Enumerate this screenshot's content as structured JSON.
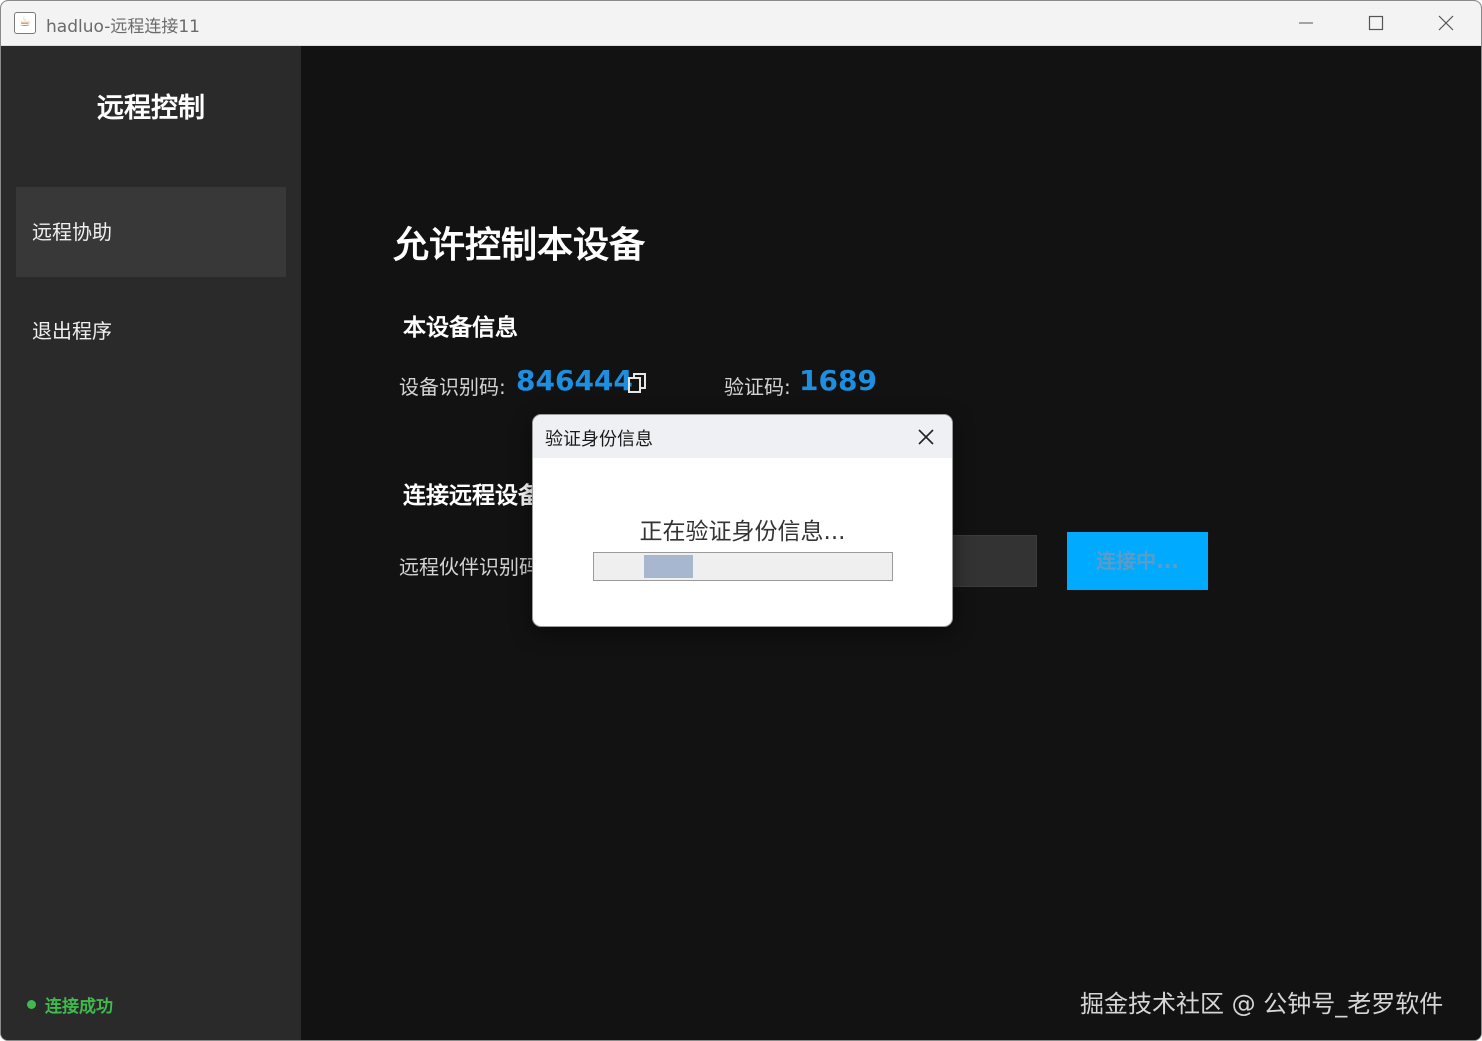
{
  "window": {
    "title": "hadluo-远程连接11",
    "icon": "java-cup-icon",
    "controls": [
      "minimize-icon",
      "maximize-icon",
      "close-icon"
    ]
  },
  "sidebar": {
    "brand": "远程控制",
    "items": [
      {
        "label": "远程协助",
        "active": true
      },
      {
        "label": "退出程序",
        "active": false
      }
    ],
    "status": "连接成功",
    "status_color": "#3fba4d"
  },
  "main": {
    "title": "允许控制本设备",
    "device_section": {
      "title": "本设备信息",
      "id_label": "设备识别码:",
      "id_value": "846444",
      "code_label": "验证码:",
      "code_value": "1689"
    },
    "connect_section": {
      "title": "连接远程设备",
      "partner_label": "远程伙伴识别码",
      "connect_button": "连接中..."
    },
    "watermark": "掘金技术社区 @ 公钟号_老罗软件"
  },
  "dialog": {
    "title": "验证身份信息",
    "message": "正在验证身份信息...",
    "progress": "indeterminate"
  },
  "colors": {
    "accent": "#1e8fe0",
    "button": "#00aaff",
    "sidebar_bg": "#2a2a2a",
    "main_bg": "#121212"
  }
}
